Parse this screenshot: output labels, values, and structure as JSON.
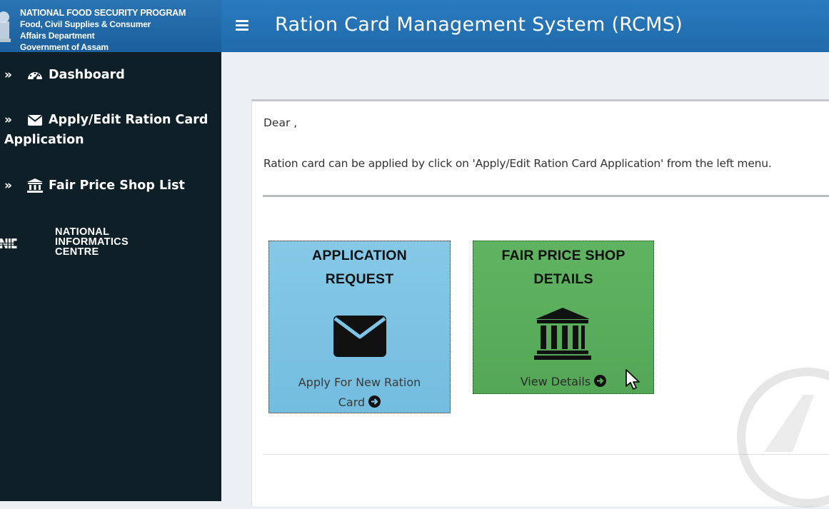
{
  "brand": {
    "line1": "NATIONAL FOOD SECURITY PROGRAM",
    "line2": "Food, Civil Supplies & Consumer",
    "line3": "Affairs Department",
    "line4": "Government of Assam",
    "emblem_icon": "state-emblem-icon"
  },
  "header": {
    "title": "Ration Card Management System (RCMS)",
    "menu_icon": "hamburger-icon"
  },
  "sidebar": {
    "items": [
      {
        "label": "Dashboard",
        "icon": "dashboard-gauge-icon"
      },
      {
        "label": "Apply/Edit Ration Card",
        "label_line2": "Application",
        "icon": "envelope-icon"
      },
      {
        "label": "Fair Price Shop List",
        "icon": "bank-building-icon"
      }
    ],
    "nic_logo": {
      "line1": "NATIONAL",
      "line2": "INFORMATICS",
      "line3": "CENTRE"
    }
  },
  "main": {
    "greeting": "Dear ,",
    "info": "Ration card can be applied by click on 'Apply/Edit Ration Card Application' from the left menu.",
    "tiles": [
      {
        "title_line1": "APPLICATION",
        "title_line2": "REQUEST",
        "link_line1": "Apply For New Ration",
        "link_line2": "Card",
        "icon": "envelope-icon"
      },
      {
        "title_line1": "FAIR PRICE SHOP",
        "title_line2": "DETAILS",
        "link_line1": "View Details",
        "icon": "bank-building-icon"
      }
    ]
  },
  "colors": {
    "sidebar_bg": "#0f1f27",
    "header_bg": "#1f6aaa",
    "tile_blue": "#7ec4e4",
    "tile_green": "#5aad5c"
  }
}
